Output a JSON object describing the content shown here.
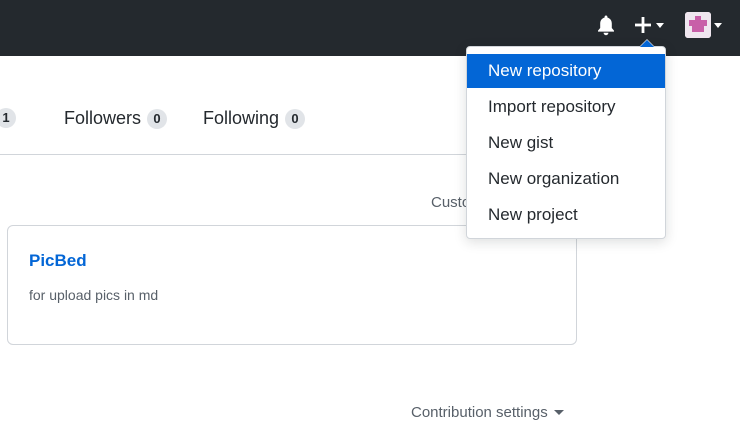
{
  "header": {
    "notifications_icon": "bell-icon",
    "create_icon": "plus-icon",
    "avatar_icon": "avatar-identicon"
  },
  "profile_tabs": {
    "partial_counter": "1",
    "followers": {
      "label": "Followers",
      "count": "0"
    },
    "following": {
      "label": "Following",
      "count": "0"
    }
  },
  "pinned": {
    "customize_label": "Custo",
    "repos": [
      {
        "name": "PicBed",
        "description": "for upload pics in md"
      }
    ]
  },
  "contributions": {
    "settings_label": "Contribution settings"
  },
  "create_menu": {
    "items": [
      {
        "label": "New repository",
        "active": true
      },
      {
        "label": "Import repository"
      },
      {
        "label": "New gist"
      },
      {
        "label": "New organization"
      },
      {
        "label": "New project"
      }
    ]
  },
  "colors": {
    "header_bg": "#24292e",
    "accent": "#0366d6",
    "muted_text": "#586069",
    "border": "#d1d5da"
  }
}
